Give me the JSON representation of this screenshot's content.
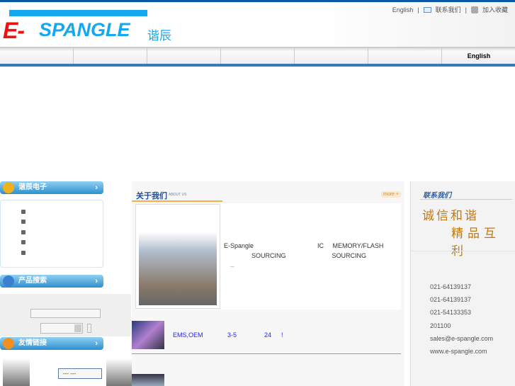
{
  "header": {
    "logo_e": "E-",
    "logo_text": "SPANGLE",
    "logo_cn": "谐辰",
    "links": [
      "English",
      "联系我们",
      "加入收藏"
    ]
  },
  "nav": {
    "items": [
      "",
      "",
      "",
      "",
      "",
      "",
      "English"
    ]
  },
  "sidebar": {
    "company_title": "谐辰电子",
    "search_title": "产品搜索",
    "links_title": "友情链接",
    "select_value": "---       ---"
  },
  "about": {
    "title": "关于我们",
    "subtitle": "ABOUT US",
    "more": "more +",
    "line1": "E-Spangle                                    IC     MEMORY/FLASH",
    "line2": "SOURCING                          SOURCING",
    "line3": "...",
    "ems_label": "EMS,OEM",
    "ems_mid": "3-5",
    "ems_num": "24",
    "ems_excl": "!"
  },
  "contact": {
    "title": "联系我们",
    "slogan1": "诚信和谐",
    "slogan2": "精品互利",
    "lines": [
      "021-64139137",
      "021-64139137",
      "021-54133353",
      "201100",
      "sales@e-spangle.com",
      "www.e-spangle.com"
    ]
  }
}
